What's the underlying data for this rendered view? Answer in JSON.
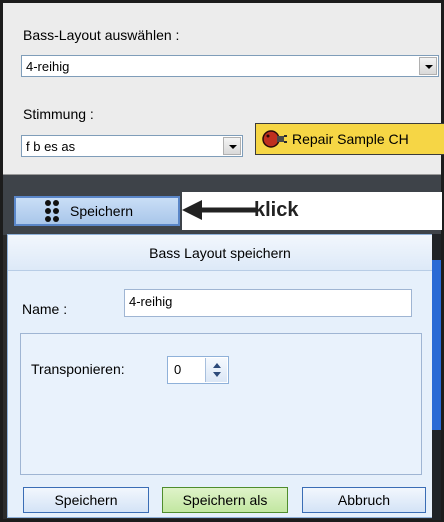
{
  "bass_layout": {
    "label": "Bass-Layout auswählen :",
    "selected": "4-reihig"
  },
  "tuning": {
    "label": "Stimmung :",
    "selected": "f b es as"
  },
  "repair_button_label": "Repair Sample CH",
  "top_save_button_label": "Speichern",
  "annotation": {
    "text": "klick"
  },
  "dialog": {
    "title": "Bass Layout speichern",
    "name_label": "Name :",
    "name_value": "4-reihig",
    "transpose_label": "Transponieren:",
    "transpose_value": "0",
    "buttons": {
      "save": "Speichern",
      "save_as": "Speichern als",
      "cancel": "Abbruch"
    }
  },
  "colors": {
    "repair_button_bg": "#f6d645",
    "dialog_bg": "#e6f0fb",
    "save_as_bg": "#c2e7a1",
    "top_save_bg": "#a9c6ea"
  }
}
